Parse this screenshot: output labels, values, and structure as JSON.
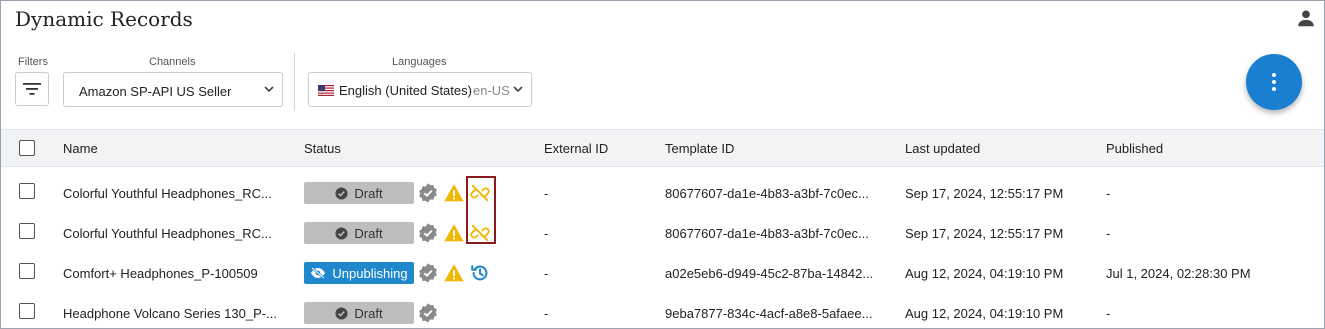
{
  "page": {
    "title": "Dynamic Records"
  },
  "filters": {
    "filters_label": "Filters",
    "channels_label": "Channels",
    "channel_value": "Amazon SP-API US Seller",
    "languages_label": "Languages",
    "language_value": "English (United States)",
    "language_code": "en-US"
  },
  "table": {
    "columns": [
      "Name",
      "Status",
      "External ID",
      "Template ID",
      "Last updated",
      "Published"
    ],
    "rows": [
      {
        "name": "Colorful Youthful Headphones_RC...",
        "status": "Draft",
        "external_id": "-",
        "template_id": "80677607-da1e-4b83-a3bf-7c0ec...",
        "last_updated": "Sep 17, 2024, 12:55:17 PM",
        "published": "-"
      },
      {
        "name": "Colorful Youthful Headphones_RC...",
        "status": "Draft",
        "external_id": "-",
        "template_id": "80677607-da1e-4b83-a3bf-7c0ec...",
        "last_updated": "Sep 17, 2024, 12:55:17 PM",
        "published": "-"
      },
      {
        "name": "Comfort+ Headphones_P-100509",
        "status": "Unpublishing",
        "external_id": "-",
        "template_id": "a02e5eb6-d949-45c2-87ba-14842...",
        "last_updated": "Aug 12, 2024, 04:19:10 PM",
        "published": "Jul 1, 2024, 02:28:30 PM"
      },
      {
        "name": "Headphone Volcano Series 130_P-...",
        "status": "Draft",
        "external_id": "-",
        "template_id": "9eba7877-834c-4acf-a8e8-5afaee...",
        "last_updated": "Aug 12, 2024, 04:19:10 PM",
        "published": "-"
      }
    ]
  },
  "colors": {
    "accent": "#1a7fd0",
    "warning": "#f2b705",
    "badge_draft": "#bdbdbd",
    "badge_unpublishing": "#1f87cc",
    "highlight": "#8b1a1a"
  },
  "icons": [
    "user-icon",
    "filter-icon",
    "chevron-down-icon",
    "us-flag-icon",
    "more-vertical-icon",
    "check-circle-icon",
    "verified-icon",
    "warning-icon",
    "unlink-icon",
    "history-icon",
    "eye-slash-icon"
  ]
}
